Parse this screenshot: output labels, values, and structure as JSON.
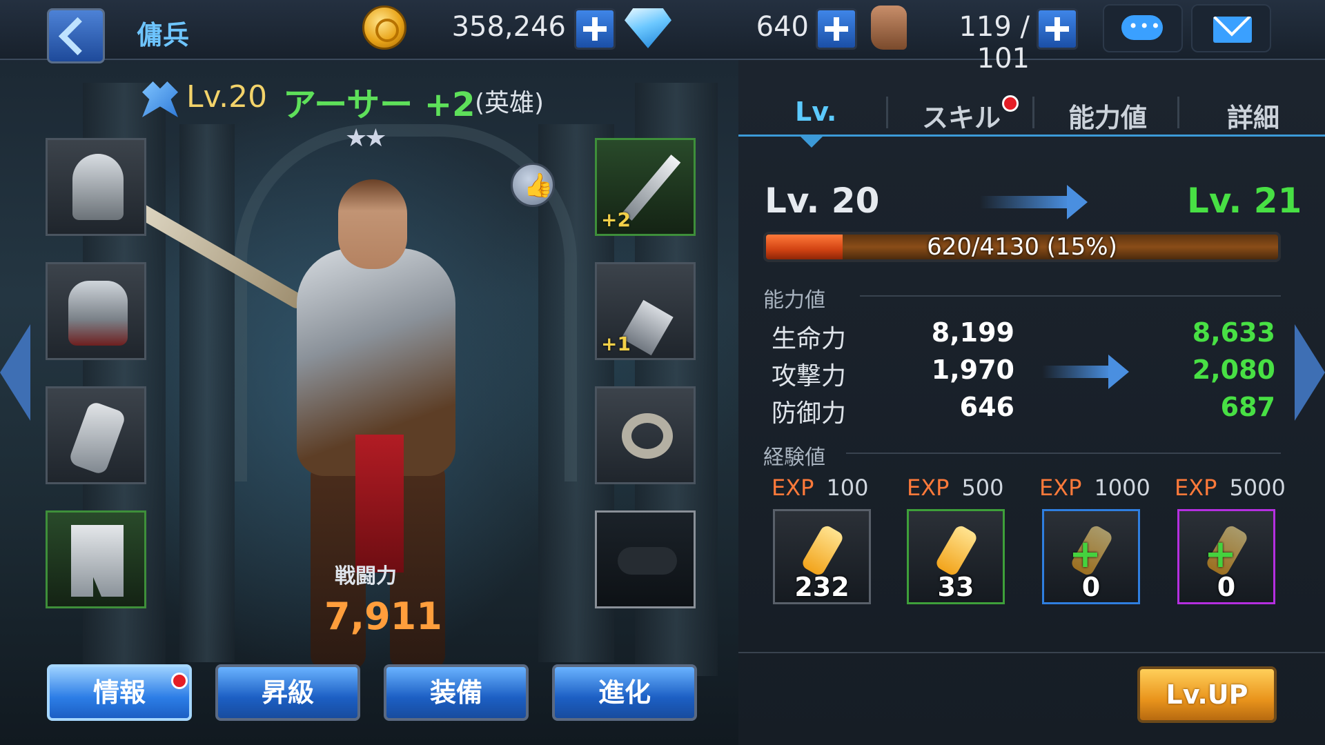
{
  "topbar": {
    "title": "傭兵",
    "gold": "358,246",
    "gems": "640",
    "stamina": "119 / 101"
  },
  "hero": {
    "level": "Lv.20",
    "name": "アーサー +2",
    "rank": "(英雄)",
    "stars": "★★",
    "combat_power_label": "戦闘力",
    "combat_power": "7,911"
  },
  "equipment": {
    "left": [
      {
        "name": "helmet"
      },
      {
        "name": "armor"
      },
      {
        "name": "gauntlet"
      },
      {
        "name": "greaves"
      }
    ],
    "right": [
      {
        "name": "sword",
        "plus": "+2"
      },
      {
        "name": "necklace",
        "plus": "+1"
      },
      {
        "name": "ring",
        "plus": ""
      },
      {
        "name": "mask",
        "plus": ""
      }
    ]
  },
  "bottom_tabs": {
    "info": "情報",
    "promote": "昇級",
    "equip": "装備",
    "evolve": "進化"
  },
  "panel": {
    "tabs": {
      "lv": "Lv.",
      "skill": "スキル",
      "ability": "能力値",
      "detail": "詳細"
    },
    "current_level": "Lv. 20",
    "next_level": "Lv. 21",
    "exp_text": "620/4130 (15%)",
    "exp_fraction": 0.15,
    "stats_label": "能力値",
    "stats": [
      {
        "name": "生命力",
        "current": "8,199",
        "next": "8,633"
      },
      {
        "name": "攻撃力",
        "current": "1,970",
        "next": "2,080"
      },
      {
        "name": "防御力",
        "current": "646",
        "next": "687"
      }
    ],
    "exp_label": "経験値",
    "potions": [
      {
        "key": "EXP",
        "value": "100",
        "count": "232",
        "rarity_color": "#59606a"
      },
      {
        "key": "EXP",
        "value": "500",
        "count": "33",
        "rarity_color": "#3ea03a"
      },
      {
        "key": "EXP",
        "value": "1000",
        "count": "0",
        "rarity_color": "#2f7fe0"
      },
      {
        "key": "EXP",
        "value": "5000",
        "count": "0",
        "rarity_color": "#b52fe0"
      }
    ],
    "lvup_button": "Lv.UP"
  },
  "colors": {
    "accent_blue": "#5ccaff",
    "stat_up_green": "#48e044",
    "combat_power_orange": "#ff9e3c",
    "hero_name_green": "#5ee05a"
  }
}
